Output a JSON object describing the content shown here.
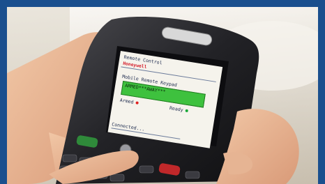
{
  "screen": {
    "title": "Remote Control",
    "brand": "Honeywell",
    "keypad_title": "Mobile Remote Keypad",
    "display_text": "ARMED***AWAY***",
    "armed_label": "Armed",
    "ready_label": "Ready",
    "status": "Connected..."
  },
  "colors": {
    "border": "#1a4f8e",
    "display_green": "#3ec13e",
    "brand_red": "#d41d2a",
    "armed_indicator": "#e02020",
    "ready_indicator": "#18a838"
  },
  "icons": [
    "armed-indicator-icon",
    "ready-indicator-icon",
    "earpiece-icon",
    "trackball-icon",
    "call-key-icon",
    "end-call-key-icon"
  ]
}
